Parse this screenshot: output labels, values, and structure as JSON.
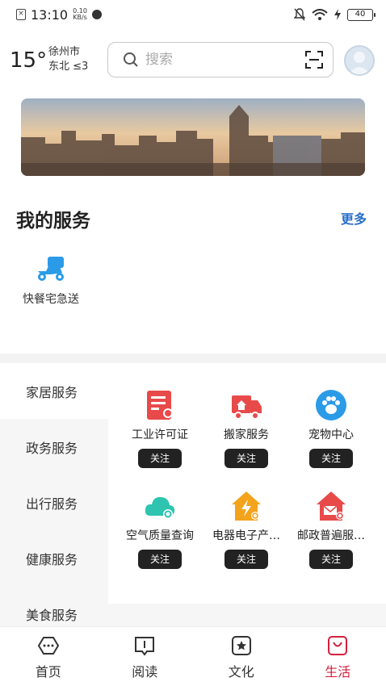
{
  "status_bar": {
    "time": "13:10",
    "speed_value": "0.10",
    "speed_unit": "KB/s",
    "battery": "40"
  },
  "weather": {
    "temperature": "15°",
    "city": "徐州市",
    "wind": "东北 ≤3"
  },
  "search": {
    "placeholder": "搜索"
  },
  "my_services": {
    "title": "我的服务",
    "more": "更多",
    "items": [
      {
        "label": "快餐宅急送",
        "icon": "scooter-icon"
      }
    ]
  },
  "categories": [
    "家居服务",
    "政务服务",
    "出行服务",
    "健康服务",
    "美食服务"
  ],
  "services": [
    {
      "name": "工业许可证",
      "button": "关注",
      "icon": "certificate-icon",
      "color": "#e84a4a"
    },
    {
      "name": "搬家服务",
      "button": "关注",
      "icon": "moving-truck-icon",
      "color": "#e84a4a"
    },
    {
      "name": "宠物中心",
      "button": "关注",
      "icon": "paw-icon",
      "color": "#2b9be8"
    },
    {
      "name": "空气质量查询",
      "button": "关注",
      "icon": "cloud-search-icon",
      "color": "#2ec4b0"
    },
    {
      "name": "电器电子产…",
      "button": "关注",
      "icon": "electric-house-icon",
      "color": "#f3a31c"
    },
    {
      "name": "邮政普遍服…",
      "button": "关注",
      "icon": "mail-house-icon",
      "color": "#e84a4a"
    }
  ],
  "tabs": [
    {
      "label": "首页",
      "icon": "home-icon",
      "active": false
    },
    {
      "label": "阅读",
      "icon": "book-icon",
      "active": false
    },
    {
      "label": "文化",
      "icon": "star-icon",
      "active": false
    },
    {
      "label": "生活",
      "icon": "bag-icon",
      "active": true
    }
  ],
  "colors": {
    "accent_red": "#d4203e",
    "link_blue": "#2a6fc9",
    "button_dark": "#222222"
  }
}
